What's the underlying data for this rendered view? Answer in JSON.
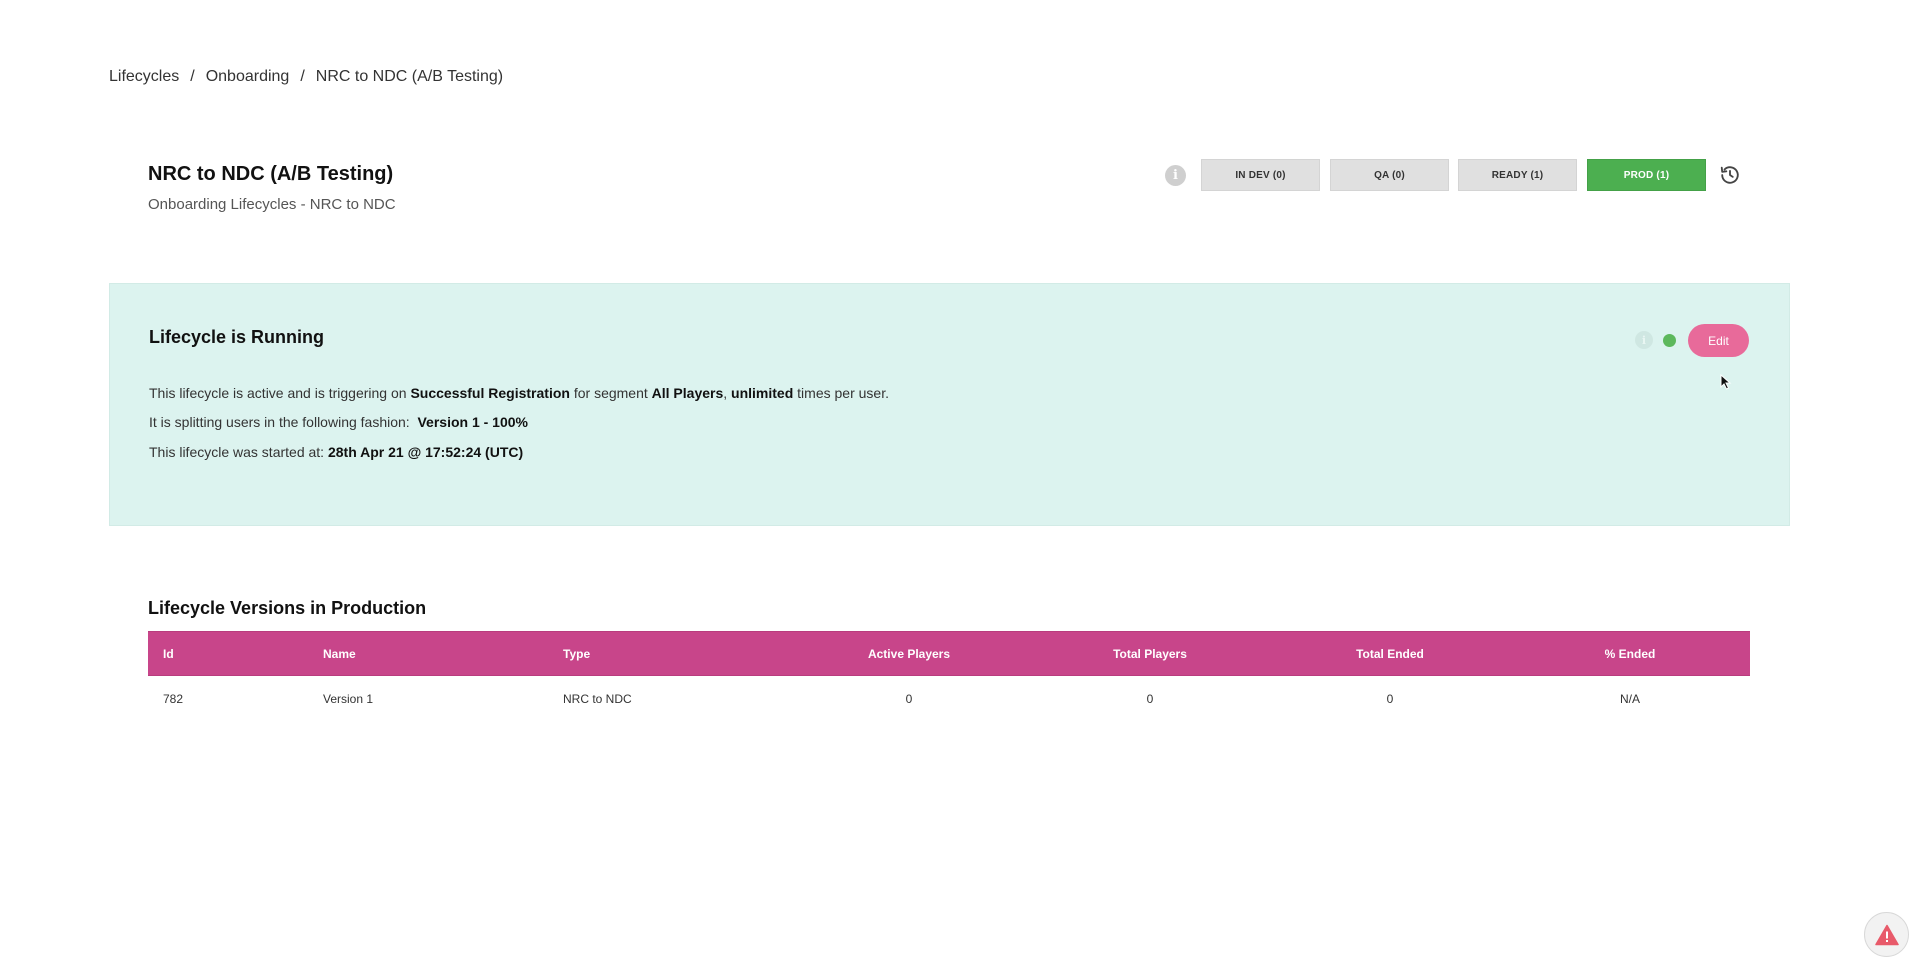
{
  "breadcrumb": {
    "items": [
      "Lifecycles",
      "Onboarding",
      "NRC to NDC (A/B Testing)"
    ],
    "separator": "/"
  },
  "header": {
    "title": "NRC to NDC (A/B Testing)",
    "subtitle": "Onboarding Lifecycles - NRC to NDC",
    "info_icon": "i",
    "stages": [
      {
        "label": "IN DEV (0)",
        "active": false
      },
      {
        "label": "QA (0)",
        "active": false
      },
      {
        "label": "READY (1)",
        "active": false
      },
      {
        "label": "PROD (1)",
        "active": true
      }
    ],
    "history_icon": "history-icon"
  },
  "status": {
    "title": "Lifecycle is Running",
    "line1": {
      "t1": "This lifecycle is active and is triggering on ",
      "trigger": "Successful Registration",
      "t2": " for segment ",
      "segment": "All Players",
      "t3": ", ",
      "frequency": "unlimited",
      "t4": " times per user."
    },
    "line2": {
      "t1": "It is splitting users in the following fashion:",
      "split": "Version 1 - 100%"
    },
    "line3": {
      "t1": "This lifecycle was started at: ",
      "started": "28th Apr 21 @ 17:52:24 (UTC)"
    },
    "info_icon": "i",
    "edit_label": "Edit",
    "running_color": "#5cb85c"
  },
  "versions": {
    "title": "Lifecycle Versions in Production",
    "headers": [
      "Id",
      "Name",
      "Type",
      "Active Players",
      "Total Players",
      "Total Ended",
      "% Ended"
    ],
    "rows": [
      [
        "782",
        "Version 1",
        "NRC to NDC",
        "0",
        "0",
        "0",
        "N/A"
      ]
    ]
  },
  "colors": {
    "accent_pink": "#c8458a",
    "edit_pink": "#e86a9a",
    "prod_green": "#4caf50",
    "panel_bg": "#dcf3ef",
    "alert_red": "#e85a6a"
  }
}
